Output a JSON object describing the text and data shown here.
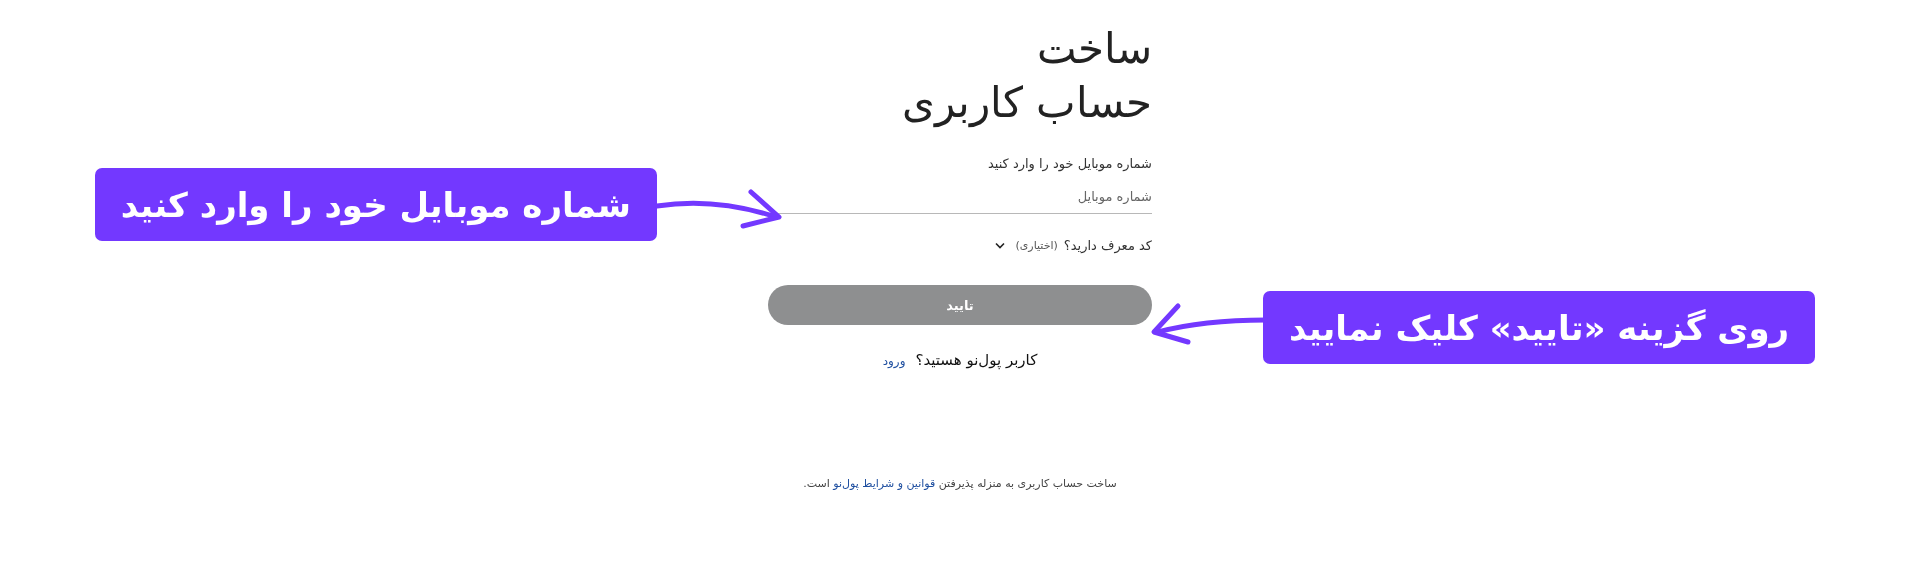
{
  "title_lines": [
    "ساخت",
    "حساب کاربری"
  ],
  "phone_field": {
    "label": "شماره موبایل خود را وارد کنید",
    "placeholder": "شماره موبایل"
  },
  "referral_toggle": {
    "label": "کد معرف دارید؟",
    "hint": "(اختیاری)",
    "expanded": false
  },
  "submit_button": {
    "label": "تایید",
    "disabled": true
  },
  "login_prompt": {
    "text": "کاربر پول‌نو هستید؟",
    "link": "ورود"
  },
  "terms_note": {
    "before": "ساخت حساب کاربری به منزله پذیرفتن",
    "link": "قوانین و شرایط پول‌نو",
    "after": "است."
  },
  "annotations": [
    {
      "text": "شماره موبایل خود را وارد کنید"
    },
    {
      "text": "روی گزینه «تایید» کلیک نمایید"
    }
  ]
}
